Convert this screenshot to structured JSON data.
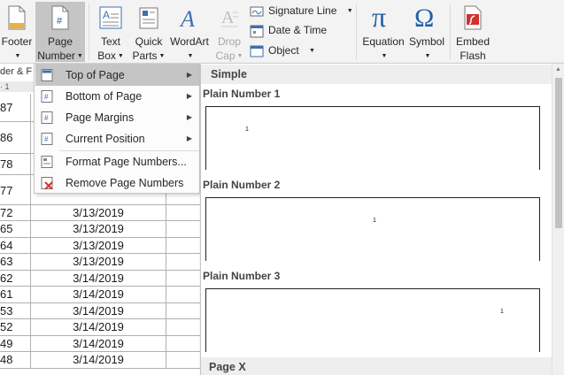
{
  "ribbon": {
    "footer": "Footer",
    "page_number_line1": "Page",
    "page_number_line2": "Number",
    "text_box_line1": "Text",
    "text_box_line2": "Box",
    "quick_parts_line1": "Quick",
    "quick_parts_line2": "Parts",
    "wordart": "WordArt",
    "drop_cap_line1": "Drop",
    "drop_cap_line2": "Cap",
    "signature_line": "Signature Line",
    "date_time": "Date & Time",
    "object": "Object",
    "equation": "Equation",
    "symbol": "Symbol",
    "embed_flash_line1": "Embed",
    "embed_flash_line2": "Flash"
  },
  "document": {
    "group_label": "der & F",
    "ruler": "· 1",
    "rows": [
      {
        "id": "87",
        "date": ""
      },
      {
        "id": "86",
        "date": ""
      },
      {
        "id": "78",
        "date": ""
      },
      {
        "id": "77",
        "date": ""
      },
      {
        "id": "72",
        "date": "3/13/2019"
      },
      {
        "id": "65",
        "date": "3/13/2019"
      },
      {
        "id": "64",
        "date": "3/13/2019"
      },
      {
        "id": "63",
        "date": "3/13/2019"
      },
      {
        "id": "62",
        "date": "3/14/2019"
      },
      {
        "id": "61",
        "date": "3/14/2019"
      },
      {
        "id": "53",
        "date": "3/14/2019"
      },
      {
        "id": "52",
        "date": "3/14/2019"
      },
      {
        "id": "49",
        "date": "3/14/2019"
      },
      {
        "id": "48",
        "date": "3/14/2019"
      }
    ]
  },
  "menu": {
    "items": [
      {
        "label": "Top of Page",
        "submenu": true
      },
      {
        "label": "Bottom of Page",
        "submenu": true
      },
      {
        "label": "Page Margins",
        "submenu": true
      },
      {
        "label": "Current Position",
        "submenu": true
      },
      {
        "label": "Format Page Numbers...",
        "submenu": false
      },
      {
        "label": "Remove Page Numbers",
        "submenu": false
      }
    ]
  },
  "gallery": {
    "section": "Simple",
    "items": [
      {
        "title": "Plain Number 1",
        "number": "1",
        "align": "left"
      },
      {
        "title": "Plain Number 2",
        "number": "1",
        "align": "center"
      },
      {
        "title": "Plain Number 3",
        "number": "1",
        "align": "right"
      }
    ],
    "next_section": "Page X"
  },
  "colors": {
    "ribbon_bg": "#f3f3f3",
    "selected_bg": "#c5c5c5",
    "equation_blue": "#1f5fa8",
    "flash_red": "#d32f2f"
  }
}
